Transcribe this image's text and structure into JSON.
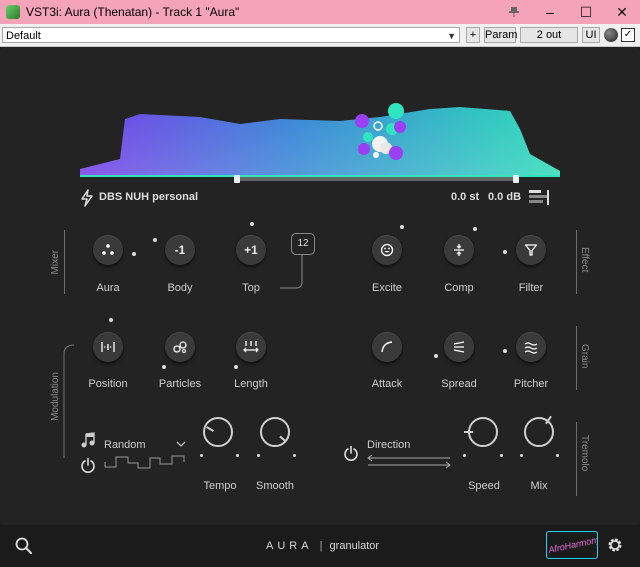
{
  "window": {
    "title": "VST3i: Aura (Thenatan) - Track 1 \"Aura\"",
    "minimize": "–",
    "maximize": "☐",
    "close": "✕"
  },
  "toolbar": {
    "preset": "Default",
    "plus": "+",
    "param": "Param",
    "output": "2 out",
    "ui": "UI"
  },
  "header": {
    "preset_name": "DBS NUH personal",
    "pitch_value": "0.0 st",
    "gain_value": "0.0 dB"
  },
  "sections": {
    "mixer": "Mixer",
    "effect": "Effect",
    "modulation": "Modulation",
    "grain": "Grain",
    "tremolo": "Tremolo"
  },
  "mixer": {
    "aura": "Aura",
    "body": "Body",
    "top": "Top",
    "body_value": "-1",
    "top_value": "+1",
    "top_badge": "12"
  },
  "effect": {
    "excite": "Excite",
    "comp": "Comp",
    "filter": "Filter"
  },
  "modulation": {
    "position": "Position",
    "particles": "Particles",
    "length": "Length",
    "shape": "Random",
    "tempo": "Tempo",
    "smooth": "Smooth"
  },
  "grain": {
    "attack": "Attack",
    "spread": "Spread",
    "pitcher": "Pitcher"
  },
  "tremolo": {
    "direction": "Direction",
    "speed": "Speed",
    "mix": "Mix"
  },
  "footer": {
    "brand": "AURA",
    "separator": "|",
    "subtitle": "granulator",
    "signature": "AfroHarmony"
  },
  "colors": {
    "accent_purple": "#7b3ff2",
    "accent_teal": "#2ee6c0",
    "accent_cyan": "#33c4d6"
  }
}
